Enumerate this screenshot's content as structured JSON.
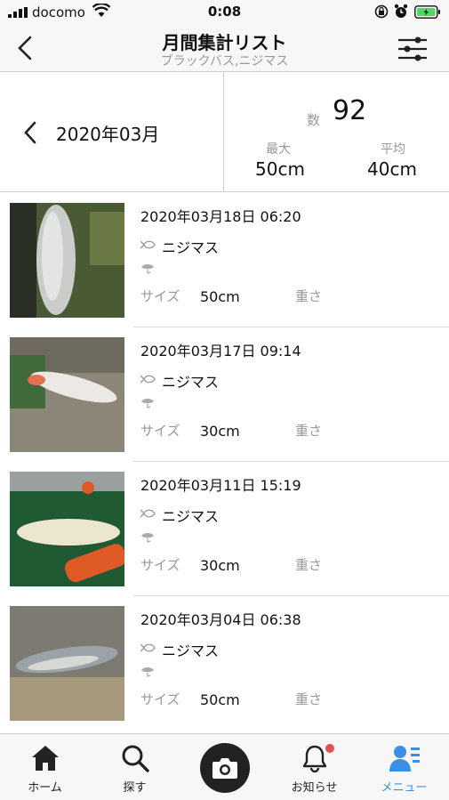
{
  "status_bar": {
    "carrier": "docomo",
    "time": "0:08"
  },
  "header": {
    "title": "月間集計リスト",
    "subtitle": "ブラックバス,ニジマス"
  },
  "summary": {
    "month": "2020年03月",
    "count_label": "数",
    "count": "92",
    "max_label": "最大",
    "max_value": "50cm",
    "avg_label": "平均",
    "avg_value": "40cm"
  },
  "catches": [
    {
      "date": "2020年03月18日 06:20",
      "species": "ニジマス",
      "size_label": "サイズ",
      "size": "50cm",
      "weight_label": "重さ"
    },
    {
      "date": "2020年03月17日 09:14",
      "species": "ニジマス",
      "size_label": "サイズ",
      "size": "30cm",
      "weight_label": "重さ"
    },
    {
      "date": "2020年03月11日 15:19",
      "species": "ニジマス",
      "size_label": "サイズ",
      "size": "30cm",
      "weight_label": "重さ"
    },
    {
      "date": "2020年03月04日 06:38",
      "species": "ニジマス",
      "size_label": "サイズ",
      "size": "50cm",
      "weight_label": "重さ"
    }
  ],
  "tabs": [
    {
      "label": "ホーム",
      "icon": "home-icon"
    },
    {
      "label": "探す",
      "icon": "search-icon"
    },
    {
      "label": "",
      "icon": "camera-icon"
    },
    {
      "label": "お知らせ",
      "icon": "bell-icon"
    },
    {
      "label": "メニュー",
      "icon": "menu-user-icon"
    }
  ],
  "colors": {
    "accent": "#3b8fe6",
    "badge": "#e25050",
    "battery": "#4cd964"
  }
}
